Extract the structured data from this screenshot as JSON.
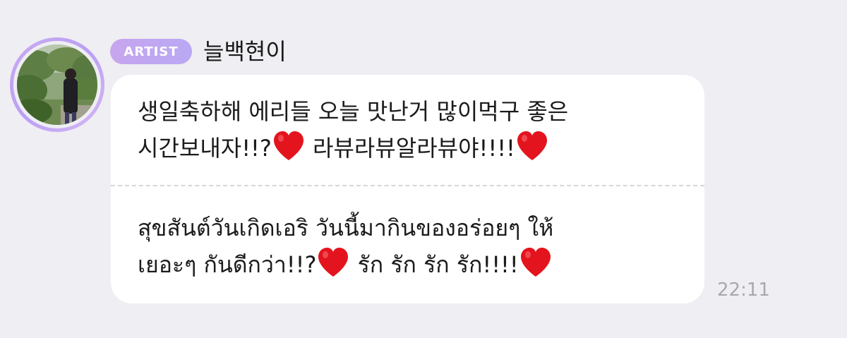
{
  "author": {
    "badge": "ARTIST",
    "name": "늘백현이",
    "avatar_icon": "profile-photo"
  },
  "message": {
    "korean": {
      "line1": "생일축하해 에리들 오늘 맛난거 많이먹구 좋은",
      "line2_a": "시간보내자!!?",
      "line2_b": " 라뷰라뷰알라뷰야!!!!"
    },
    "thai": {
      "line1": "สุขสันต์วันเกิดเอริ วันนี้มากินของอร่อยๆ ให้",
      "line2_a": "เยอะๆ กันดีกว่า!!?",
      "line2_b": " รัก รัก รัก รัก!!!!"
    },
    "heart_icon": "red-heart-icon",
    "heart_color": "#e3141e"
  },
  "timestamp": "22:11",
  "colors": {
    "background": "#efeef3",
    "bubble": "#ffffff",
    "badge_start": "#c7a6ee",
    "badge_end": "#b9a8f4",
    "timestamp": "#a9a9ad"
  }
}
